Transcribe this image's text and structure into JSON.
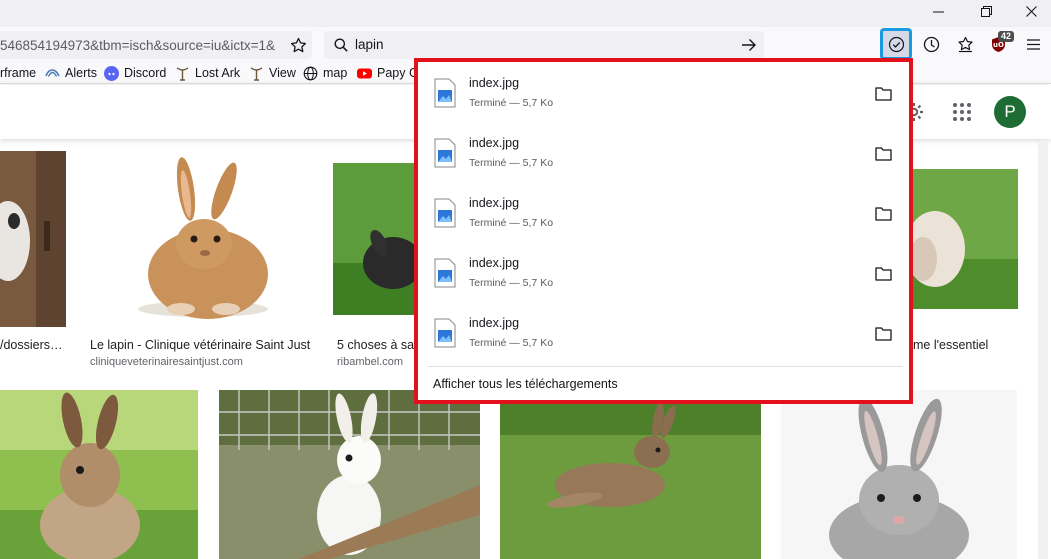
{
  "urlbar": {
    "url": "546854194973&tbm=isch&source=iu&ictx=1&"
  },
  "search": {
    "query": "lapin"
  },
  "toolbar": {
    "notification_count": "42"
  },
  "bookmarks": [
    {
      "label": "rframe",
      "icon": "page-icon"
    },
    {
      "label": "Alerts",
      "icon": "alerts-icon"
    },
    {
      "label": "Discord",
      "icon": "discord-icon"
    },
    {
      "label": "Lost Ark",
      "icon": "lost-ark-icon"
    },
    {
      "label": "View",
      "icon": "lost-ark-icon"
    },
    {
      "label": "map",
      "icon": "globe-icon"
    },
    {
      "label": "Papy G",
      "icon": "youtube-icon"
    }
  ],
  "google": {
    "avatar_letter": "P"
  },
  "results": [
    {
      "caption": "/dossiers…",
      "source": ""
    },
    {
      "caption": "Le lapin - Clinique vétérinaire Saint Just",
      "source": "cliniqueveterinairesaintjust.com"
    },
    {
      "caption": "5 choses à sa",
      "source": "ribambel.com"
    },
    {
      "caption": "me l'essentiel",
      "source": ""
    }
  ],
  "downloads": {
    "items": [
      {
        "name": "index.jpg",
        "status": "Terminé — 5,7 Ko"
      },
      {
        "name": "index.jpg",
        "status": "Terminé — 5,7 Ko"
      },
      {
        "name": "index.jpg",
        "status": "Terminé — 5,7 Ko"
      },
      {
        "name": "index.jpg",
        "status": "Terminé — 5,7 Ko"
      },
      {
        "name": "index.jpg",
        "status": "Terminé — 5,7 Ko"
      }
    ],
    "show_all": "Afficher tous les téléchargements"
  },
  "colors": {
    "accent_highlight": "#1a9ae0",
    "panel_outline": "#e3111b"
  }
}
